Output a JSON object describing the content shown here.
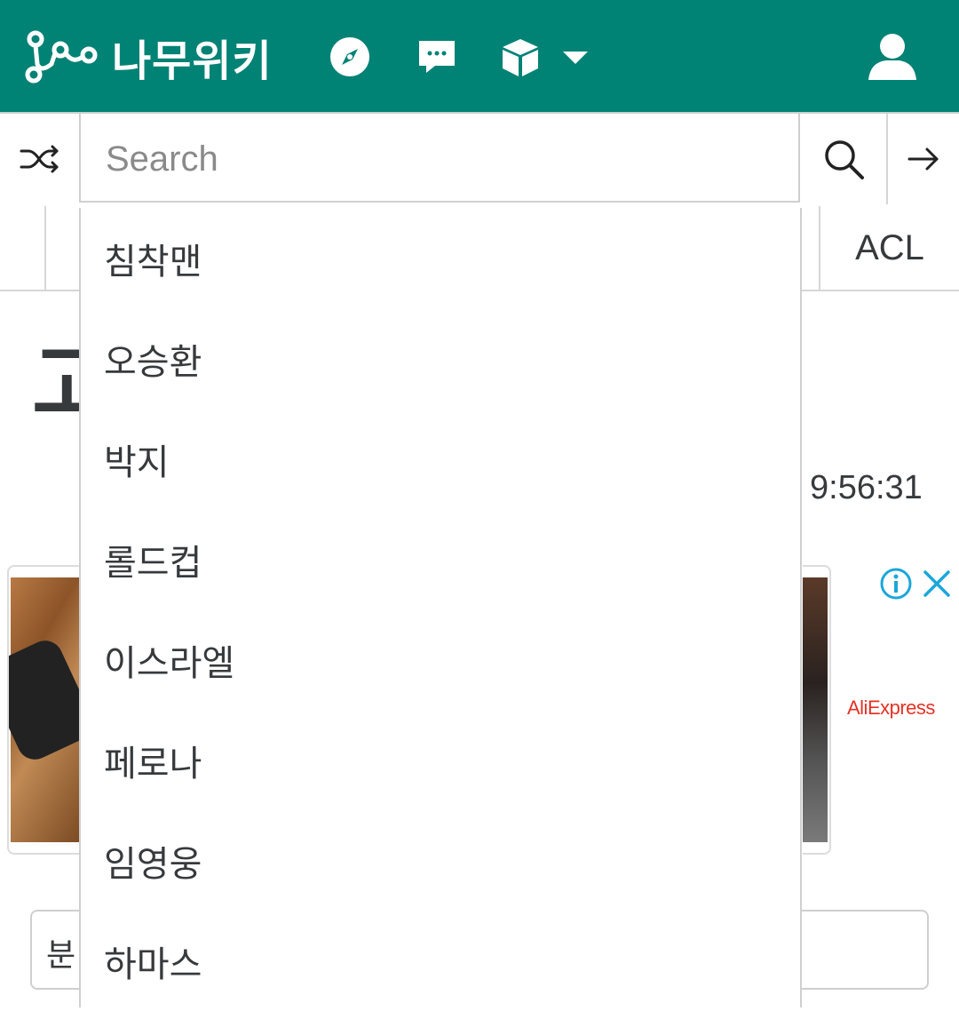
{
  "header": {
    "logo_text": "나무위키",
    "icons": [
      "recent-changes-compass-icon",
      "discussion-chat-icon",
      "tools-cube-icon",
      "dropdown-caret-icon",
      "user-icon"
    ],
    "colors": {
      "brand": "#008275",
      "ad_brand": "#e43225",
      "ad_icon": "#1ba7d9"
    }
  },
  "search": {
    "placeholder": "Search",
    "value": "",
    "suggestions": [
      "침착맨",
      "오승환",
      "박지",
      "롤드컵",
      "이스라엘",
      "페로나",
      "임영웅",
      "하마스"
    ]
  },
  "tabs": {
    "acl_label": "ACL"
  },
  "page": {
    "title_fragment": "고",
    "timestamp_fragment": "9:56:31",
    "category_label_fragment": "분"
  },
  "ad": {
    "brand": "AliExpress"
  }
}
